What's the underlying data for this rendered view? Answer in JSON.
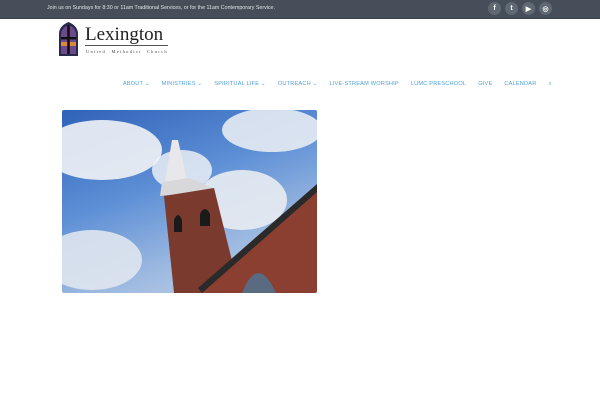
{
  "topbar": {
    "message": "Join us on Sundays for 8:30 or 11am Traditional Services, or for the 11am Contemporary Service.",
    "social": [
      {
        "icon": "facebook-icon",
        "glyph": "f"
      },
      {
        "icon": "twitter-icon",
        "glyph": "t"
      },
      {
        "icon": "youtube-icon",
        "glyph": "▶"
      },
      {
        "icon": "instagram-icon",
        "glyph": "◎"
      }
    ]
  },
  "logo": {
    "title": "Lexington",
    "subtitle": "United Methodist Church"
  },
  "nav": {
    "items": [
      "ABOUT ⌄",
      "MINISTRIES ⌄",
      "SPIRITUAL LIFE ⌄",
      "OUTREACH ⌄",
      "LIVE-STREAM WORSHIP",
      "LUMC PRESCHOOL",
      "GIVE",
      "CALENDAR"
    ],
    "search_glyph": "🔍"
  },
  "colors": {
    "topbar": "#464f59",
    "link": "#4fa3d8"
  }
}
